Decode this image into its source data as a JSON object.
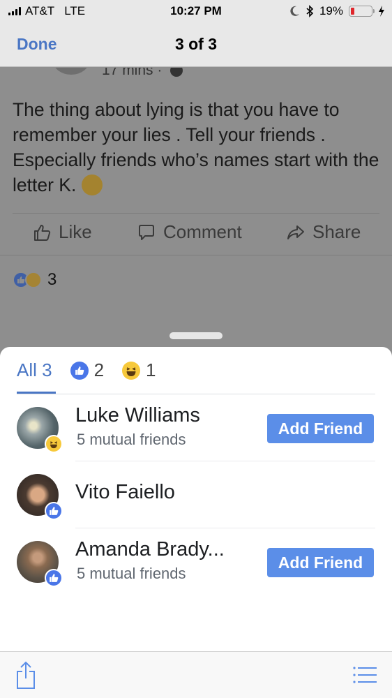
{
  "status_bar": {
    "carrier": "AT&T",
    "network": "LTE",
    "time": "10:27 PM",
    "battery_percent": "19%",
    "battery_level": 0.19,
    "icons": [
      "signal-icon",
      "moon-icon",
      "bluetooth-icon",
      "battery-icon",
      "charging-bolt-icon"
    ]
  },
  "nav": {
    "done_label": "Done",
    "title": "3 of 3"
  },
  "post": {
    "time": "17 mins",
    "separator": "·",
    "text": "The thing about lying is that you have to remember your lies . Tell your friends . Especially friends who’s names start with the letter K.",
    "actions": {
      "like": "Like",
      "comment": "Comment",
      "share": "Share"
    },
    "reaction_count": "3"
  },
  "sheet": {
    "tabs": {
      "all_label": "All 3",
      "like_count": "2",
      "haha_count": "1"
    },
    "people": [
      {
        "name": "Luke Williams",
        "mutual": "5 mutual friends",
        "reaction": "haha",
        "button": "Add Friend"
      },
      {
        "name": "Vito Faiello",
        "mutual": "",
        "reaction": "like",
        "button": ""
      },
      {
        "name": "Amanda Brady...",
        "mutual": "5 mutual friends",
        "reaction": "like",
        "button": "Add Friend"
      }
    ]
  },
  "colors": {
    "accent": "#4a76c4",
    "button": "#5b8ee8",
    "like": "#4a76e8",
    "haha": "#f7c93b",
    "battery_low": "#e0262b",
    "overlay": "#8e8e8e"
  }
}
